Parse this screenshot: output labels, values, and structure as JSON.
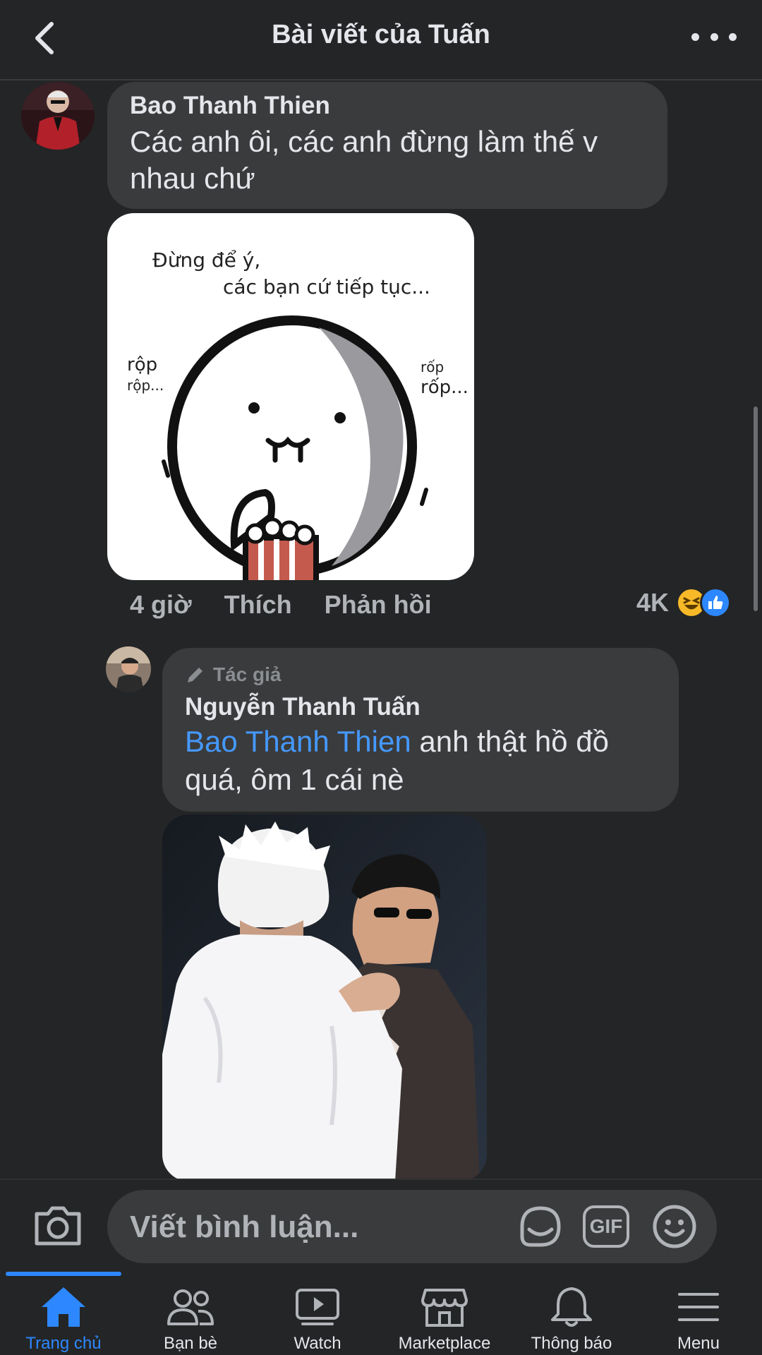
{
  "header": {
    "title": "Bài viết của Tuấn"
  },
  "comment1": {
    "author": "Bao Thanh Thien",
    "text_line1": "Các anh ôi, các anh đừng làm thế v",
    "text_line2": "nhau chứ",
    "sticker": {
      "caption_line1": "Đừng để ý,",
      "caption_line2": "các bạn cứ tiếp tục...",
      "sound_left_1": "rộp",
      "sound_left_2": "rộp...",
      "sound_right_1": "rốp",
      "sound_right_2": "rốp..."
    },
    "time": "4 giờ",
    "like_label": "Thích",
    "reply_label": "Phản hồi",
    "reaction_count": "4K",
    "reaction_icons": [
      "haha-icon",
      "like-icon"
    ]
  },
  "reply1": {
    "badge": "Tác giả",
    "author": "Nguyễn Thanh Tuấn",
    "mention": "Bao Thanh Thien",
    "text_after_mention": " anh thật hồ đồ",
    "text_line2": "quá, ôm 1 cái nè"
  },
  "composer": {
    "placeholder": "Viết bình luận...",
    "gif_label": "GIF"
  },
  "nav": {
    "items": [
      {
        "label": "Trang chủ",
        "icon": "home-icon",
        "active": true
      },
      {
        "label": "Bạn bè",
        "icon": "friends-icon",
        "active": false
      },
      {
        "label": "Watch",
        "icon": "watch-icon",
        "active": false
      },
      {
        "label": "Marketplace",
        "icon": "marketplace-icon",
        "active": false
      },
      {
        "label": "Thông báo",
        "icon": "bell-icon",
        "active": false
      },
      {
        "label": "Menu",
        "icon": "menu-icon",
        "active": false
      }
    ]
  },
  "colors": {
    "background": "#242526",
    "bubble": "#3a3b3c",
    "accent": "#2d88ff",
    "mention": "#4599ff"
  }
}
